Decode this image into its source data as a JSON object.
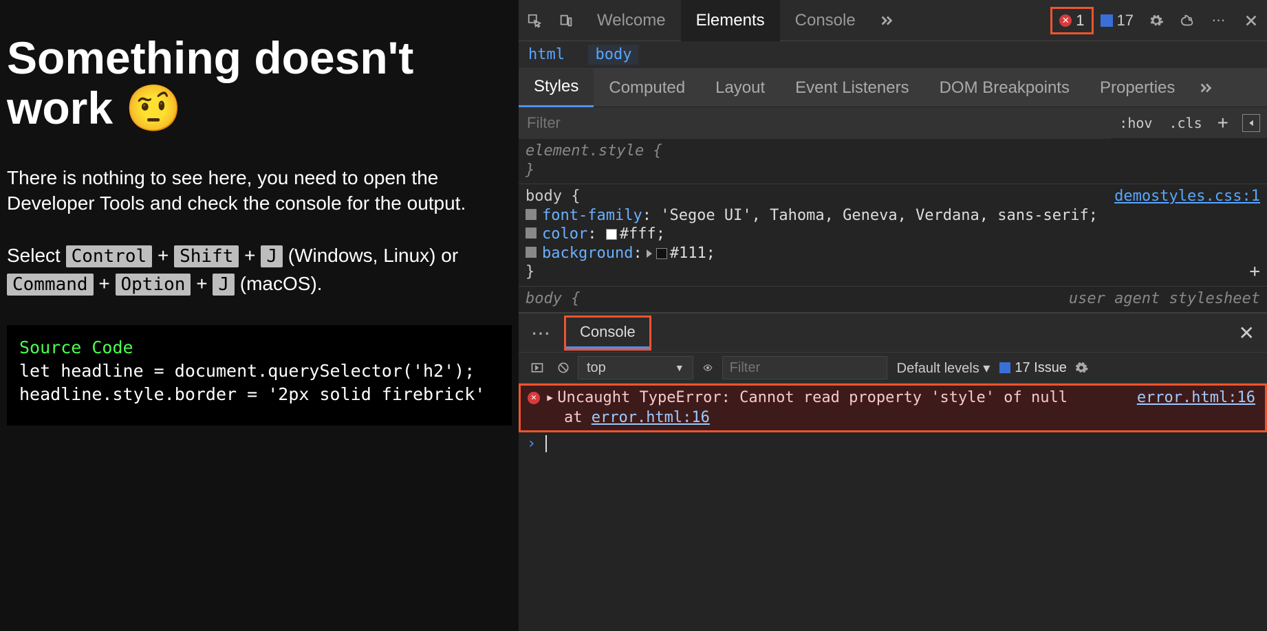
{
  "page": {
    "heading": "Something doesn't work 🤨",
    "para": "There is nothing to see here, you need to open the Developer Tools and check the console for the output.",
    "select": "Select ",
    "win_suffix": " (Windows, Linux) or ",
    "mac_suffix": " (macOS).",
    "kbd": {
      "ctrl": "Control",
      "shift": "Shift",
      "j": "J",
      "cmd": "Command",
      "opt": "Option"
    },
    "code_title": "Source Code",
    "code_l1": "let headline = document.querySelector('h2');",
    "code_l2": "headline.style.border = '2px solid firebrick'"
  },
  "top_tabs": {
    "welcome": "Welcome",
    "elements": "Elements",
    "console": "Console"
  },
  "badges": {
    "errors": "1",
    "issues": "17"
  },
  "crumbs": {
    "a": "html",
    "b": "body"
  },
  "style_tabs": [
    "Styles",
    "Computed",
    "Layout",
    "Event Listeners",
    "DOM Breakpoints",
    "Properties"
  ],
  "styles_toolbar": {
    "filter_ph": "Filter",
    "hov": ":hov",
    "cls": ".cls"
  },
  "styles": {
    "elstyle_open": "element.style {",
    "elstyle_close": "}",
    "body_open": "body {",
    "body_close": "}",
    "link": "demostyles.css:1",
    "rules": [
      {
        "prop": "font-family",
        "val": "'Segoe UI', Tahoma, Geneva, Verdana, sans-serif;"
      },
      {
        "prop": "color",
        "val": "#fff;",
        "swatch": "#fff"
      },
      {
        "prop": "background",
        "val": "#111;",
        "swatch": "#111",
        "tri": true
      }
    ],
    "ua_open": "body {",
    "ua_label": "user agent stylesheet"
  },
  "drawer": {
    "tab": "Console",
    "context": "top",
    "filter_ph": "Filter",
    "levels": "Default levels ▾",
    "issue_badge": "17 Issue"
  },
  "error": {
    "msg": "Uncaught TypeError: Cannot read property 'style' of null",
    "at": "    at ",
    "src": "error.html:16"
  }
}
